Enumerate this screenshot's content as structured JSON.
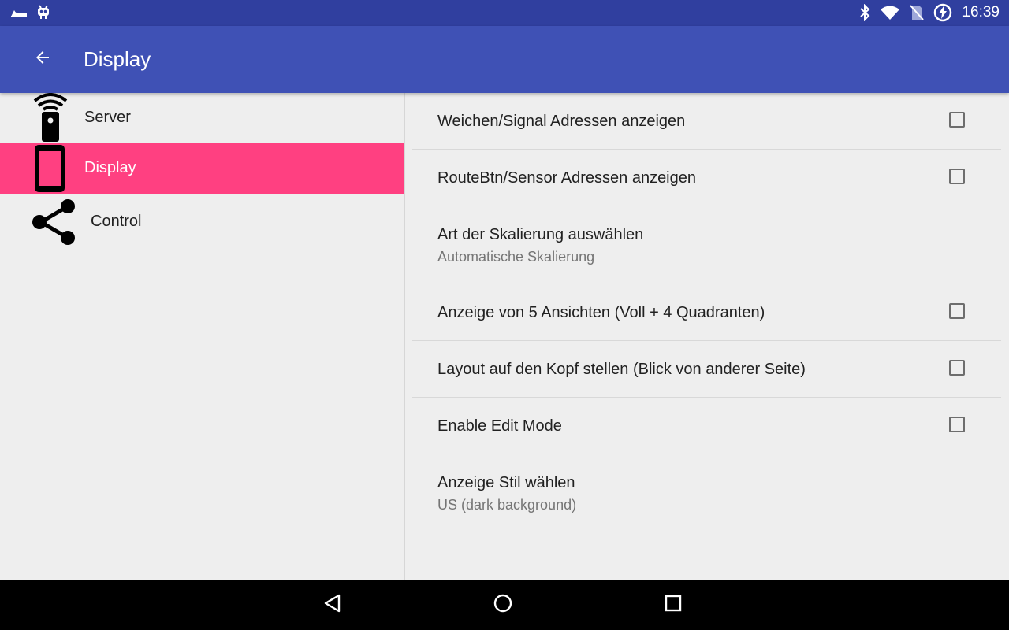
{
  "status_bar": {
    "time": "16:39",
    "icons": [
      "signal-icon",
      "cyanogen-bug-icon",
      "bluetooth-icon",
      "wifi-icon",
      "no-sim-icon",
      "battery-charging-icon"
    ]
  },
  "app_bar": {
    "title": "Display",
    "back_icon": "arrow-back-icon"
  },
  "headers": [
    {
      "label": "Server",
      "icon": "remote-control-icon",
      "active": false
    },
    {
      "label": "Display",
      "icon": "phone-icon",
      "active": true
    },
    {
      "label": "Control",
      "icon": "share-icon",
      "active": false
    }
  ],
  "preferences": [
    {
      "title": "Weichen/Signal Adressen anzeigen",
      "summary": "",
      "checkbox": true,
      "checked": false
    },
    {
      "title": "RouteBtn/Sensor Adressen anzeigen",
      "summary": "",
      "checkbox": true,
      "checked": false
    },
    {
      "title": "Art der Skalierung auswählen",
      "summary": "Automatische Skalierung",
      "checkbox": false
    },
    {
      "title": "Anzeige von 5 Ansichten (Voll + 4 Quadranten)",
      "summary": "",
      "checkbox": true,
      "checked": false
    },
    {
      "title": "Layout auf den Kopf stellen (Blick von anderer Seite)",
      "summary": "",
      "checkbox": true,
      "checked": false
    },
    {
      "title": "Enable Edit Mode",
      "summary": "",
      "checkbox": true,
      "checked": false
    },
    {
      "title": "Anzeige Stil wählen",
      "summary": "US (dark background)",
      "checkbox": false
    }
  ],
  "nav_bar": {
    "buttons": [
      "back-triangle-icon",
      "home-circle-icon",
      "recents-square-icon"
    ]
  },
  "colors": {
    "status_bar": "#303f9f",
    "app_bar": "#3f51b5",
    "accent": "#ff4081",
    "background": "#eeeeee"
  }
}
